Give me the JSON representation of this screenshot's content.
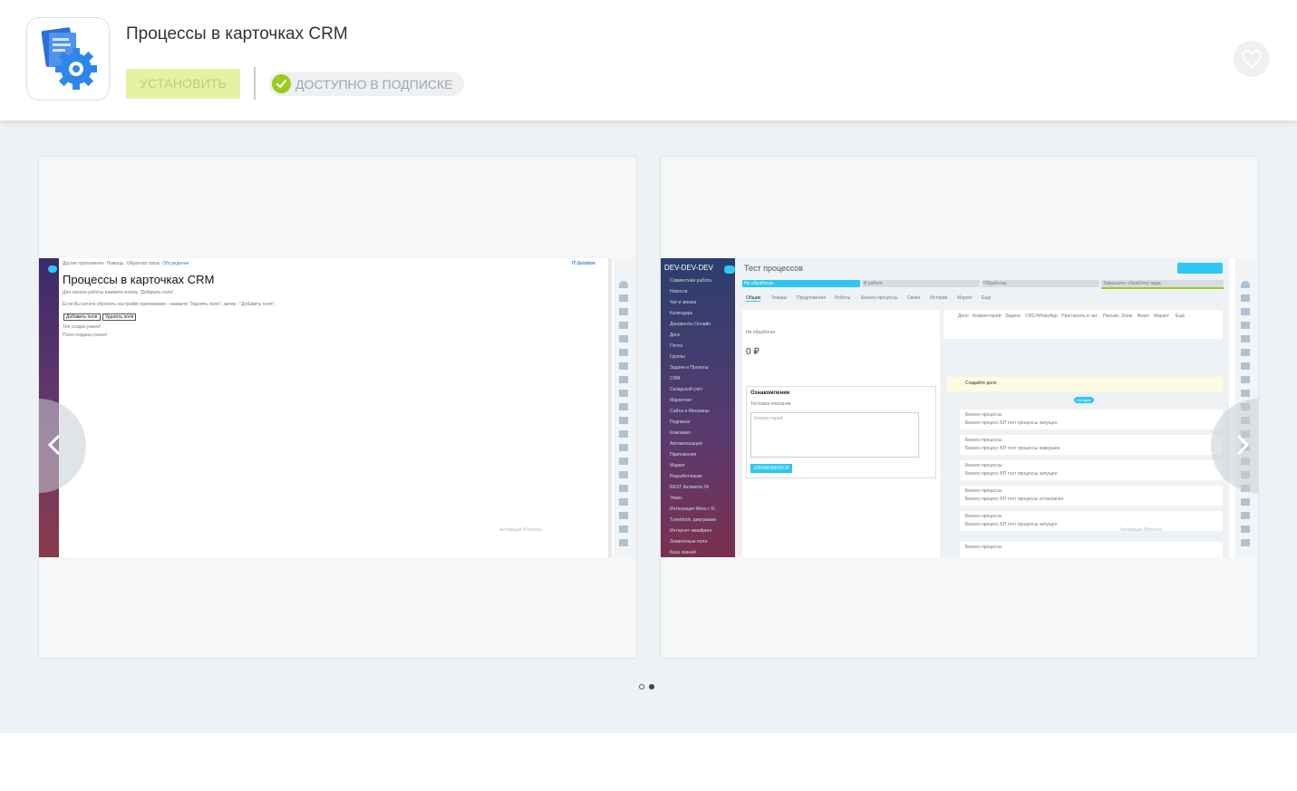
{
  "app": {
    "title": "Процессы в карточках CRM",
    "install_label": "УСТАНОВИТЬ",
    "subscription_label": "ДОСТУПНО В ПОДПИСКЕ",
    "icon": "document-gear-icon",
    "favorite_icon": "heart-icon"
  },
  "colors": {
    "install_bg": "#e5f2a6",
    "check": "#9acb1f",
    "bitrix_blue": "#2fc6f6"
  },
  "gallery": {
    "active_dot": 2,
    "dots": 2
  },
  "shot1": {
    "topbar": [
      "Другие приложения",
      "Помощь",
      "Обратная связь",
      "Обсуждение"
    ],
    "brand": "IT-Solution",
    "heading": "Процессы в карточках CRM",
    "line1": "Для начала работы нажмите кнопку \"Добавить поля\".",
    "line2": "Если Вы хотите сбросить настройки приложения - нажмите \"Удалить поля\", затем - \"Добавить поля\".",
    "btn_add": "Добавить поля",
    "btn_delete": "Удалить поля",
    "note1": "Тип создан ранее!",
    "note2": "Поля созданы ранее!",
    "watermark": "Активация Windows"
  },
  "shot2": {
    "brand": "DEV-DEV-DEV",
    "page_title": "Тест процессов",
    "stages": [
      "Не обработан",
      "В работе",
      "Обработан",
      "Завершить обработку лида"
    ],
    "tabs": [
      "Общие",
      "Товары",
      "Предложения",
      "Роботы",
      "Бизнес-процессы",
      "Связи",
      "История",
      "Маркет",
      "Ещё"
    ],
    "menu": [
      "Совместная работа",
      "Новости",
      "Чат и звонки",
      "Календарь",
      "Документы Онлайн",
      "Диск",
      "Почта",
      "Группы",
      "Задачи и Проекты",
      "CRM",
      "Складской учёт",
      "Маркетинг",
      "Сайты и Магазины",
      "Подписки",
      "Компания",
      "Автоматизация",
      "Приложения",
      "Маркет",
      "Разработчикам",
      "REST Активити 24",
      "Эникс",
      "Интеграция Мега с Я...",
      "Tuneblock: диаграмма",
      "Интернет-эквайринг",
      "Заявленные поля",
      "База знаний"
    ],
    "stage_label": "Не обработан",
    "amount": "0 ₽",
    "card_title": "Ознакомление",
    "card_desc": "Тестовое описание",
    "comment_placeholder": "Комментарий",
    "card_button": "ОЗНАКОМИЛСЯ",
    "right_tabs": [
      "Дело",
      "Комментарий",
      "Задача",
      "СМС/WhatsApp",
      "Пригласить в чат",
      "Письмо",
      "Зоом",
      "Визит",
      "Маркет",
      "Ещё"
    ],
    "create_task": "Создайте дело",
    "today_label": "Сегодня",
    "feed": [
      {
        "title": "Бизнес-процессы",
        "text": "Бизнес-процесс БП тест процессы запущен"
      },
      {
        "title": "Бизнес-процессы",
        "text": "Бизнес-процесс БП тест процессы завершен"
      },
      {
        "title": "Бизнес-процессы",
        "text": "Бизнес-процесс БП тест процессы запущен"
      },
      {
        "title": "Бизнес-процессы",
        "text": "Бизнес-процесс БП тест процессы остановлен"
      },
      {
        "title": "Бизнес-процессы",
        "text": "Бизнес-процесс БП тест процессы запущен"
      },
      {
        "title": "Бизнес-процессы",
        "text": ""
      }
    ],
    "watermark": "Активация Windows"
  }
}
